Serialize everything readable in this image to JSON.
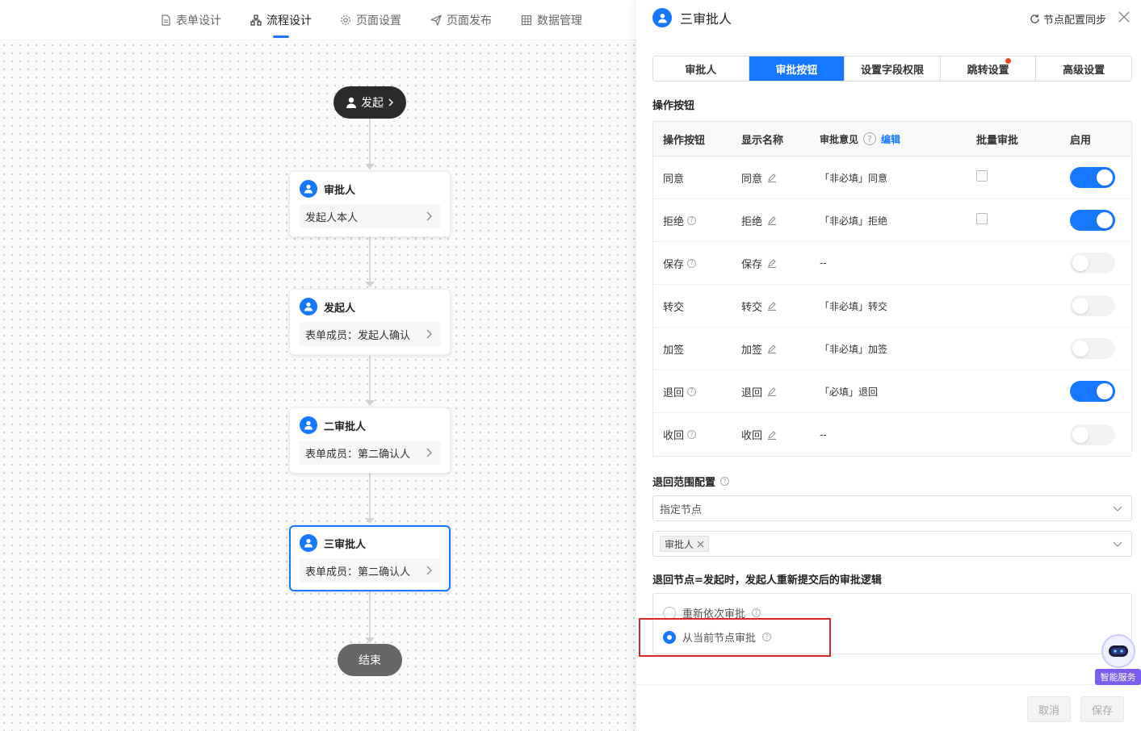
{
  "nav": {
    "items": [
      {
        "label": "表单设计",
        "icon": "document-icon"
      },
      {
        "label": "流程设计",
        "icon": "flow-icon",
        "active": true
      },
      {
        "label": "页面设置",
        "icon": "gear-icon"
      },
      {
        "label": "页面发布",
        "icon": "send-icon"
      },
      {
        "label": "数据管理",
        "icon": "grid-icon"
      }
    ]
  },
  "flow": {
    "start_label": "发起",
    "end_label": "结束",
    "nodes": [
      {
        "title": "审批人",
        "body": "发起人本人"
      },
      {
        "title": "发起人",
        "body": "表单成员：发起人确认"
      },
      {
        "title": "二审批人",
        "body": "表单成员：第二确认人"
      },
      {
        "title": "三审批人",
        "body": "表单成员：第二确认人",
        "selected": true
      }
    ]
  },
  "panel": {
    "title": "三审批人",
    "sync_label": "节点配置同步",
    "tabs": [
      {
        "label": "审批人"
      },
      {
        "label": "审批按钮",
        "active": true
      },
      {
        "label": "设置字段权限"
      },
      {
        "label": "跳转设置",
        "has_dot": true
      },
      {
        "label": "高级设置"
      }
    ],
    "ops_title": "操作按钮",
    "table": {
      "headers": {
        "button": "操作按钮",
        "display": "显示名称",
        "opinion": "审批意见",
        "edit": "编辑",
        "batch": "批量审批",
        "enabled": "启用"
      },
      "rows": [
        {
          "name": "同意",
          "help": false,
          "display": "同意",
          "opinion": "「非必填」同意",
          "batch": true,
          "enabled": true
        },
        {
          "name": "拒绝",
          "help": true,
          "display": "拒绝",
          "opinion": "「非必填」拒绝",
          "batch": true,
          "enabled": true
        },
        {
          "name": "保存",
          "help": true,
          "display": "保存",
          "opinion": "--",
          "batch": false,
          "enabled": false
        },
        {
          "name": "转交",
          "help": false,
          "display": "转交",
          "opinion": "「非必填」转交",
          "batch": false,
          "enabled": false
        },
        {
          "name": "加签",
          "help": false,
          "display": "加签",
          "opinion": "「非必填」加签",
          "batch": false,
          "enabled": false
        },
        {
          "name": "退回",
          "help": true,
          "display": "退回",
          "opinion": "「必填」退回",
          "batch": false,
          "enabled": true
        },
        {
          "name": "收回",
          "help": true,
          "display": "收回",
          "opinion": "--",
          "batch": false,
          "enabled": false
        }
      ]
    },
    "return_scope": {
      "title": "退回范围配置",
      "select_value": "指定节点",
      "tag": "审批人"
    },
    "return_logic": {
      "title": "退回节点=发起时，发起人重新提交后的审批逻辑",
      "options": [
        {
          "label": "重新依次审批",
          "checked": false
        },
        {
          "label": "从当前节点审批",
          "checked": true
        }
      ]
    },
    "cancel_label": "取消",
    "save_label": "保存"
  },
  "assistant": {
    "label": "智能服务"
  },
  "colors": {
    "accent": "#1677ff",
    "highlight": "#d9252c",
    "dot": "#f5432c",
    "assistant": "#7b5cf0"
  }
}
